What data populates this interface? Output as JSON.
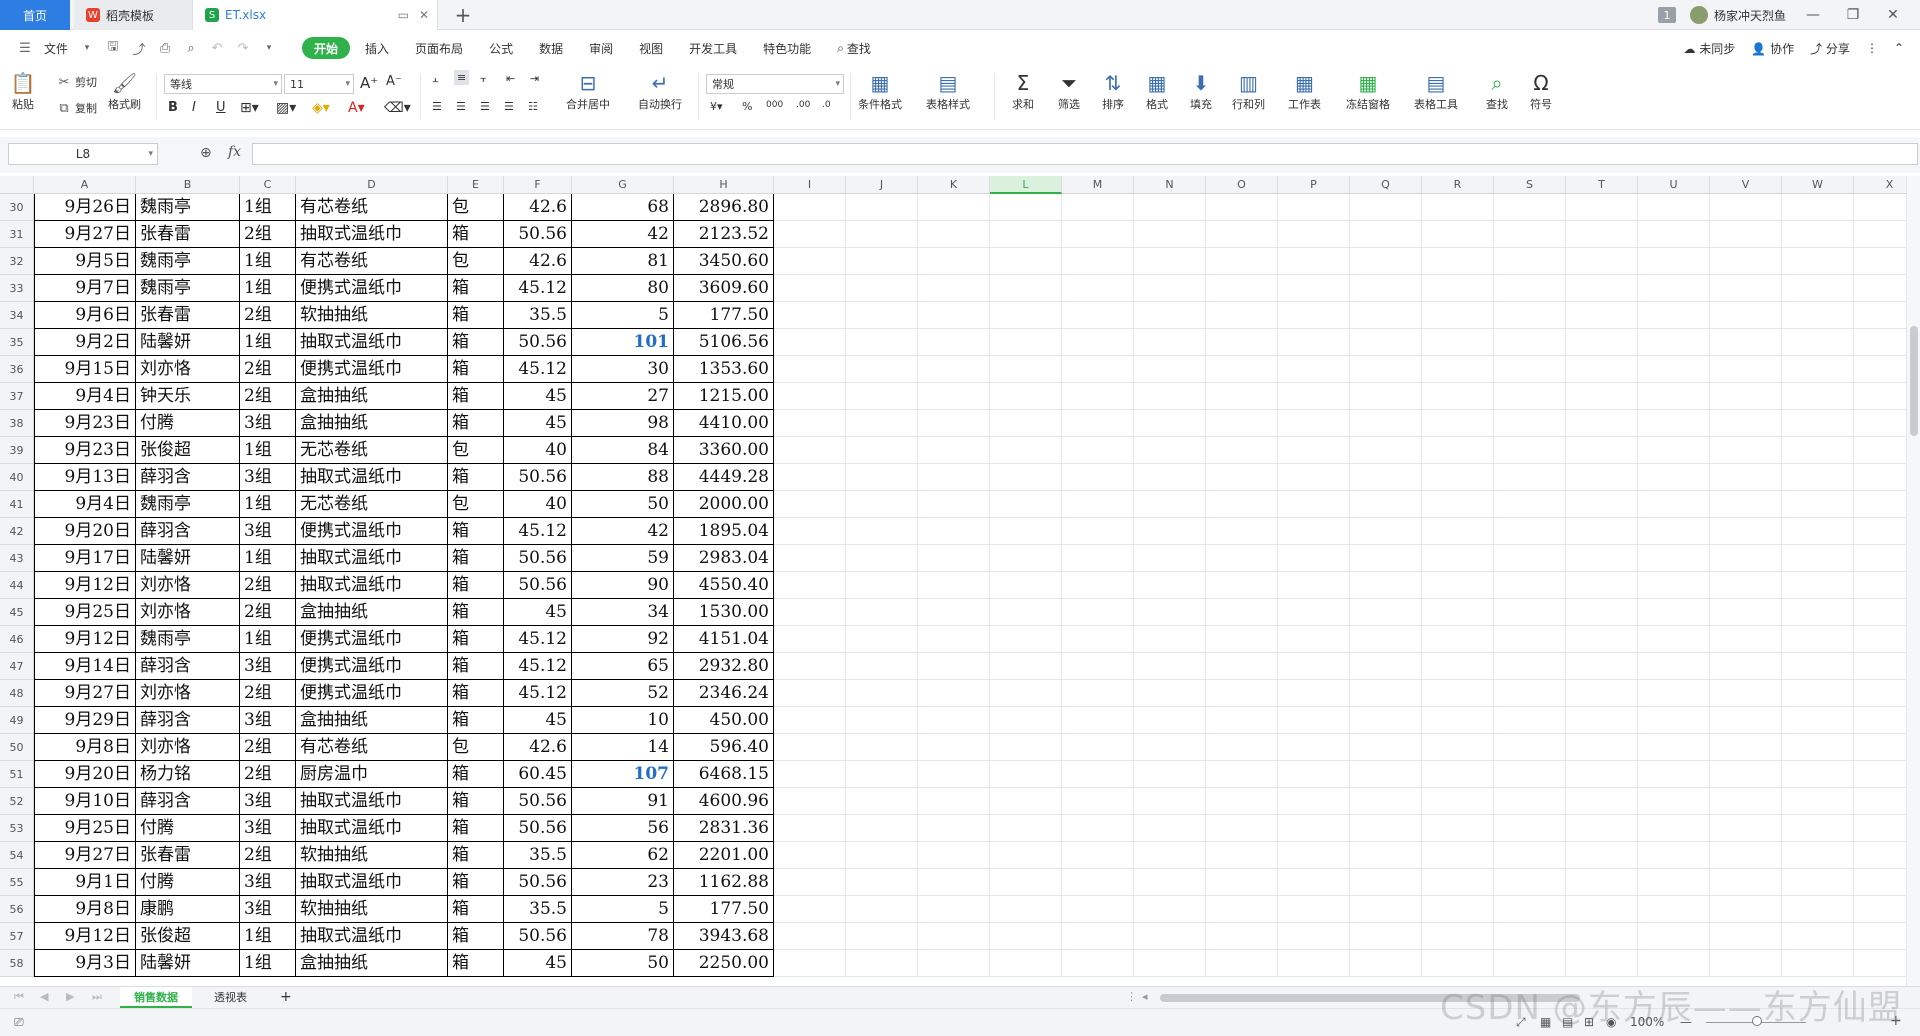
{
  "tabs": {
    "home": "首页",
    "template": "稻壳模板",
    "file": "ET.xlsx",
    "new_tab": "+"
  },
  "window": {
    "badge": "1",
    "user": "杨家冲天烈鱼",
    "minimize": "—",
    "restore": "❐",
    "close": "✕"
  },
  "menu": {
    "file": "文件",
    "items": [
      "开始",
      "插入",
      "页面布局",
      "公式",
      "数据",
      "审阅",
      "视图",
      "开发工具",
      "特色功能"
    ],
    "search": "查找",
    "sync": "未同步",
    "collab": "协作",
    "share": "分享"
  },
  "ribbon": {
    "paste": "粘贴",
    "cut": "剪切",
    "copy": "复制",
    "format_painter": "格式刷",
    "font_name": "等线",
    "font_size": "11",
    "merge": "合并居中",
    "wrap": "自动换行",
    "number_format": "常规",
    "cond_format": "条件格式",
    "table_style": "表格样式",
    "sum": "求和",
    "filter": "筛选",
    "sort": "排序",
    "format": "格式",
    "fill": "填充",
    "rowcol": "行和列",
    "worksheet": "工作表",
    "freeze": "冻结窗格",
    "table_tools": "表格工具",
    "find": "查找",
    "symbol": "符号"
  },
  "formula": {
    "name_box": "L8",
    "fx": "fx",
    "value": ""
  },
  "columns": [
    "A",
    "B",
    "C",
    "D",
    "E",
    "F",
    "G",
    "H",
    "I",
    "J",
    "K",
    "L",
    "M",
    "N",
    "O",
    "P",
    "Q",
    "R",
    "S",
    "T",
    "U",
    "V",
    "W",
    "X"
  ],
  "active_column": "L",
  "rows": [
    {
      "n": "30",
      "a": "9月26日",
      "b": "魏雨亭",
      "c": "1组",
      "d": "有芯卷纸",
      "e": "包",
      "f": "42.6",
      "g": "68",
      "h": "2896.80"
    },
    {
      "n": "31",
      "a": "9月27日",
      "b": "张春雷",
      "c": "2组",
      "d": "抽取式温纸巾",
      "e": "箱",
      "f": "50.56",
      "g": "42",
      "h": "2123.52"
    },
    {
      "n": "32",
      "a": "9月5日",
      "b": "魏雨亭",
      "c": "1组",
      "d": "有芯卷纸",
      "e": "包",
      "f": "42.6",
      "g": "81",
      "h": "3450.60"
    },
    {
      "n": "33",
      "a": "9月7日",
      "b": "魏雨亭",
      "c": "1组",
      "d": "便携式温纸巾",
      "e": "箱",
      "f": "45.12",
      "g": "80",
      "h": "3609.60"
    },
    {
      "n": "34",
      "a": "9月6日",
      "b": "张春雷",
      "c": "2组",
      "d": "软抽抽纸",
      "e": "箱",
      "f": "35.5",
      "g": "5",
      "h": "177.50"
    },
    {
      "n": "35",
      "a": "9月2日",
      "b": "陆馨妍",
      "c": "1组",
      "d": "抽取式温纸巾",
      "e": "箱",
      "f": "50.56",
      "g": "101",
      "h": "5106.56",
      "blue": true
    },
    {
      "n": "36",
      "a": "9月15日",
      "b": "刘亦恪",
      "c": "2组",
      "d": "便携式温纸巾",
      "e": "箱",
      "f": "45.12",
      "g": "30",
      "h": "1353.60"
    },
    {
      "n": "37",
      "a": "9月4日",
      "b": "钟天乐",
      "c": "2组",
      "d": "盒抽抽纸",
      "e": "箱",
      "f": "45",
      "g": "27",
      "h": "1215.00"
    },
    {
      "n": "38",
      "a": "9月23日",
      "b": "付腾",
      "c": "3组",
      "d": "盒抽抽纸",
      "e": "箱",
      "f": "45",
      "g": "98",
      "h": "4410.00"
    },
    {
      "n": "39",
      "a": "9月23日",
      "b": "张俊超",
      "c": "1组",
      "d": "无芯卷纸",
      "e": "包",
      "f": "40",
      "g": "84",
      "h": "3360.00"
    },
    {
      "n": "40",
      "a": "9月13日",
      "b": "薛羽含",
      "c": "3组",
      "d": "抽取式温纸巾",
      "e": "箱",
      "f": "50.56",
      "g": "88",
      "h": "4449.28"
    },
    {
      "n": "41",
      "a": "9月4日",
      "b": "魏雨亭",
      "c": "1组",
      "d": "无芯卷纸",
      "e": "包",
      "f": "40",
      "g": "50",
      "h": "2000.00"
    },
    {
      "n": "42",
      "a": "9月20日",
      "b": "薛羽含",
      "c": "3组",
      "d": "便携式温纸巾",
      "e": "箱",
      "f": "45.12",
      "g": "42",
      "h": "1895.04"
    },
    {
      "n": "43",
      "a": "9月17日",
      "b": "陆馨妍",
      "c": "1组",
      "d": "抽取式温纸巾",
      "e": "箱",
      "f": "50.56",
      "g": "59",
      "h": "2983.04"
    },
    {
      "n": "44",
      "a": "9月12日",
      "b": "刘亦恪",
      "c": "2组",
      "d": "抽取式温纸巾",
      "e": "箱",
      "f": "50.56",
      "g": "90",
      "h": "4550.40"
    },
    {
      "n": "45",
      "a": "9月25日",
      "b": "刘亦恪",
      "c": "2组",
      "d": "盒抽抽纸",
      "e": "箱",
      "f": "45",
      "g": "34",
      "h": "1530.00"
    },
    {
      "n": "46",
      "a": "9月12日",
      "b": "魏雨亭",
      "c": "1组",
      "d": "便携式温纸巾",
      "e": "箱",
      "f": "45.12",
      "g": "92",
      "h": "4151.04"
    },
    {
      "n": "47",
      "a": "9月14日",
      "b": "薛羽含",
      "c": "3组",
      "d": "便携式温纸巾",
      "e": "箱",
      "f": "45.12",
      "g": "65",
      "h": "2932.80"
    },
    {
      "n": "48",
      "a": "9月27日",
      "b": "刘亦恪",
      "c": "2组",
      "d": "便携式温纸巾",
      "e": "箱",
      "f": "45.12",
      "g": "52",
      "h": "2346.24"
    },
    {
      "n": "49",
      "a": "9月29日",
      "b": "薛羽含",
      "c": "3组",
      "d": "盒抽抽纸",
      "e": "箱",
      "f": "45",
      "g": "10",
      "h": "450.00"
    },
    {
      "n": "50",
      "a": "9月8日",
      "b": "刘亦恪",
      "c": "2组",
      "d": "有芯卷纸",
      "e": "包",
      "f": "42.6",
      "g": "14",
      "h": "596.40"
    },
    {
      "n": "51",
      "a": "9月20日",
      "b": "杨力铭",
      "c": "2组",
      "d": "厨房温巾",
      "e": "箱",
      "f": "60.45",
      "g": "107",
      "h": "6468.15",
      "blue": true
    },
    {
      "n": "52",
      "a": "9月10日",
      "b": "薛羽含",
      "c": "3组",
      "d": "抽取式温纸巾",
      "e": "箱",
      "f": "50.56",
      "g": "91",
      "h": "4600.96"
    },
    {
      "n": "53",
      "a": "9月25日",
      "b": "付腾",
      "c": "3组",
      "d": "抽取式温纸巾",
      "e": "箱",
      "f": "50.56",
      "g": "56",
      "h": "2831.36"
    },
    {
      "n": "54",
      "a": "9月27日",
      "b": "张春雷",
      "c": "2组",
      "d": "软抽抽纸",
      "e": "箱",
      "f": "35.5",
      "g": "62",
      "h": "2201.00"
    },
    {
      "n": "55",
      "a": "9月1日",
      "b": "付腾",
      "c": "3组",
      "d": "抽取式温纸巾",
      "e": "箱",
      "f": "50.56",
      "g": "23",
      "h": "1162.88"
    },
    {
      "n": "56",
      "a": "9月8日",
      "b": "康鹏",
      "c": "3组",
      "d": "软抽抽纸",
      "e": "箱",
      "f": "35.5",
      "g": "5",
      "h": "177.50"
    },
    {
      "n": "57",
      "a": "9月12日",
      "b": "张俊超",
      "c": "1组",
      "d": "抽取式温纸巾",
      "e": "箱",
      "f": "50.56",
      "g": "78",
      "h": "3943.68"
    },
    {
      "n": "58",
      "a": "9月3日",
      "b": "陆馨妍",
      "c": "1组",
      "d": "盒抽抽纸",
      "e": "箱",
      "f": "45",
      "g": "50",
      "h": "2250.00"
    }
  ],
  "sheets": {
    "active": "销售数据",
    "other": "透视表",
    "add": "+"
  },
  "status": {
    "zoom": "100%",
    "zoom_minus": "—",
    "zoom_plus": "+"
  },
  "watermark": "CSDN @东方辰——东方仙盟"
}
